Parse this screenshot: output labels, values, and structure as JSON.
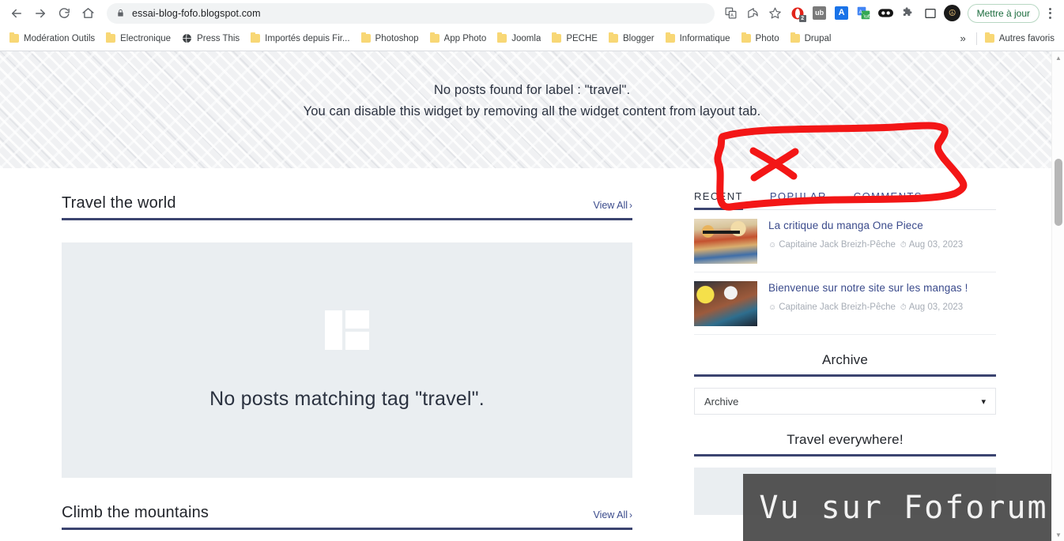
{
  "browser": {
    "url": "essai-blog-fofo.blogspot.com",
    "nav": {
      "back": "back-arrow",
      "forward": "forward-arrow",
      "reload": "reload",
      "home": "home"
    },
    "toolbar_icons": [
      {
        "name": "translate-icon",
        "glyph": "文",
        "color": "#5f6368"
      },
      {
        "name": "share-icon",
        "glyph": "",
        "color": "#5f6368"
      },
      {
        "name": "bookmark-star-icon",
        "glyph": "☆",
        "color": "#5f6368"
      },
      {
        "name": "opera-extension-icon",
        "glyph": "O",
        "color": "#e2231a",
        "badge": "2"
      },
      {
        "name": "ublock-extension-icon",
        "glyph": "ub",
        "color": "#7a7a7a"
      },
      {
        "name": "grammar-extension-icon",
        "glyph": "A",
        "color": "#1a73e8"
      },
      {
        "name": "google-translate-extension-icon",
        "glyph": "G",
        "color": "#4285f4"
      },
      {
        "name": "dark-reader-extension-icon",
        "glyph": "●●",
        "color": "#111111"
      },
      {
        "name": "extensions-puzzle-icon",
        "glyph": "❖",
        "color": "#5f6368"
      },
      {
        "name": "sidepanel-icon",
        "glyph": "□",
        "color": "#5f6368"
      }
    ],
    "profile_avatar": "profile-avatar",
    "update_button": "Mettre à jour",
    "menu": "chrome-menu"
  },
  "bookmarks": {
    "items": [
      {
        "label": "Modération Outils",
        "icon": "folder-icon"
      },
      {
        "label": "Electronique",
        "icon": "folder-icon"
      },
      {
        "label": "Press This",
        "icon": "globe-icon"
      },
      {
        "label": "Importés depuis Fir...",
        "icon": "folder-icon"
      },
      {
        "label": "Photoshop",
        "icon": "folder-icon"
      },
      {
        "label": "App Photo",
        "icon": "folder-icon"
      },
      {
        "label": "Joomla",
        "icon": "folder-icon"
      },
      {
        "label": "PECHE",
        "icon": "folder-icon"
      },
      {
        "label": "Blogger",
        "icon": "folder-icon"
      },
      {
        "label": "Informatique",
        "icon": "folder-icon"
      },
      {
        "label": "Photo",
        "icon": "folder-icon"
      },
      {
        "label": "Drupal",
        "icon": "folder-icon"
      }
    ],
    "overflow": "»",
    "other_bookmarks": {
      "label": "Autres favoris",
      "icon": "folder-icon"
    }
  },
  "banner": {
    "line1": "No posts found for label : \"travel\".",
    "line2": "You can disable this widget by removing all the widget content from layout tab."
  },
  "main": {
    "sections": [
      {
        "title": "Travel the world",
        "view_all": "View All",
        "view_all_chevron": "›",
        "empty_message": "No posts matching tag \"travel\"."
      },
      {
        "title": "Climb the mountains",
        "view_all": "View All",
        "view_all_chevron": "›"
      }
    ]
  },
  "sidebar": {
    "tabs": [
      {
        "label": "RECENT",
        "active": true
      },
      {
        "label": "POPULAR",
        "active": false
      },
      {
        "label": "COMMENTS",
        "active": false
      }
    ],
    "posts": [
      {
        "title": "La critique du manga One Piece",
        "author": "Capitaine Jack Breizh-Pêche",
        "date": "Aug 03, 2023",
        "thumb": "manga-one-piece-thumbnail",
        "author_icon": "user-icon",
        "date_icon": "clock-icon"
      },
      {
        "title": "Bienvenue sur notre site sur les mangas !",
        "author": "Capitaine Jack Breizh-Pêche",
        "date": "Aug 03, 2023",
        "thumb": "manga-welcome-thumbnail",
        "author_icon": "user-icon",
        "date_icon": "clock-icon"
      }
    ],
    "archive": {
      "title": "Archive",
      "select_value": "Archive",
      "chevron": "˅"
    },
    "travel_widget": {
      "title": "Travel everywhere!"
    }
  },
  "annotation": {
    "shape": "red-hand-drawn-rectangle-with-cross",
    "color": "#f31616"
  },
  "watermark": {
    "text": "Vu sur Foforum",
    "background": "#484848"
  },
  "colors": {
    "accent_navy": "#3b4470",
    "link_blue": "#3b4b8c",
    "empty_box_bg": "#eaeef1",
    "banner_bg": "#f0f1f3"
  }
}
